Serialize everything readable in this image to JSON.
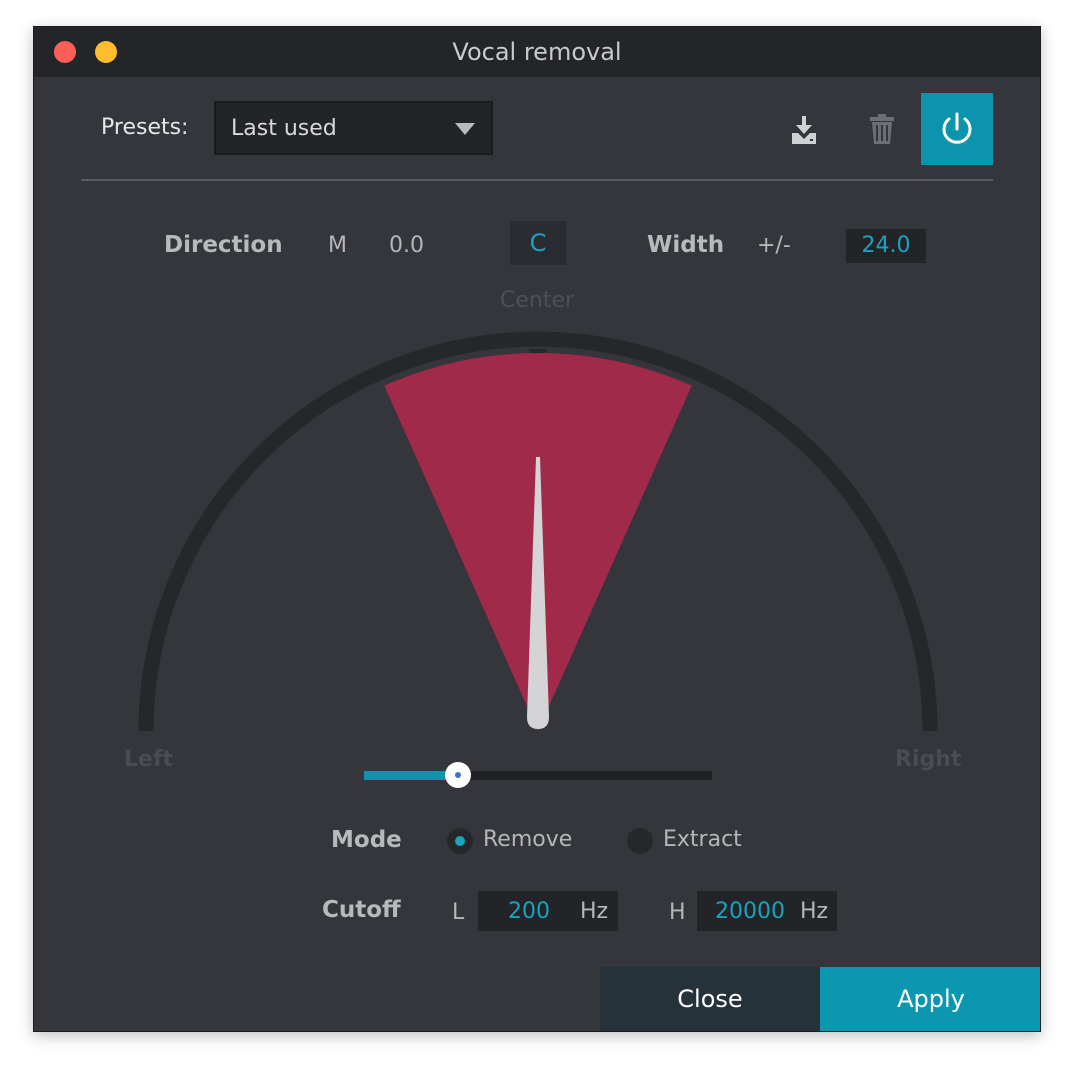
{
  "window": {
    "title": "Vocal removal"
  },
  "presets": {
    "label": "Presets:",
    "selected": "Last used"
  },
  "toolbar": {
    "save_icon": "save-download-icon",
    "delete_icon": "trash-icon",
    "power_icon": "power-icon",
    "power_color": "#0c93ad"
  },
  "direction": {
    "label": "Direction",
    "mode_letter": "M",
    "value": "0.0",
    "center_button": "C"
  },
  "width": {
    "label": "Width",
    "plusminus": "+/-",
    "value": "24.0"
  },
  "dial": {
    "center_label": "Center",
    "left_label": "Left",
    "right_label": "Right",
    "sector_color": "#a1294a",
    "width_degrees": 24.0,
    "direction_degrees": 0.0
  },
  "slider": {
    "fraction": 0.27,
    "color": "#0c93ad"
  },
  "mode": {
    "label": "Mode",
    "options": [
      "Remove",
      "Extract"
    ],
    "selected": "Remove"
  },
  "cutoff": {
    "label": "Cutoff",
    "low": {
      "prefix": "L",
      "value": "200",
      "unit": "Hz"
    },
    "high": {
      "prefix": "H",
      "value": "20000",
      "unit": "Hz"
    }
  },
  "buttons": {
    "close": "Close",
    "apply": "Apply"
  }
}
